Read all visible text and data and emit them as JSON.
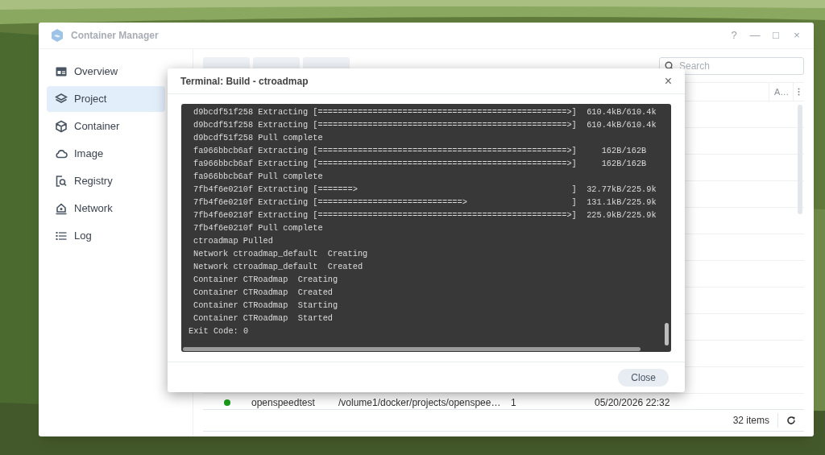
{
  "window": {
    "title": "Container Manager",
    "controls": [
      "?",
      "—",
      "□",
      "×"
    ]
  },
  "sidebar": {
    "items": [
      {
        "label": "Overview",
        "selected": false
      },
      {
        "label": "Project",
        "selected": true
      },
      {
        "label": "Container",
        "selected": false
      },
      {
        "label": "Image",
        "selected": false
      },
      {
        "label": "Registry",
        "selected": false
      },
      {
        "label": "Network",
        "selected": false
      },
      {
        "label": "Log",
        "selected": false
      }
    ]
  },
  "toolbar": {
    "search": {
      "placeholder": "Search"
    }
  },
  "table": {
    "columns": [
      {
        "label": "A…"
      }
    ],
    "rows": [
      {
        "color": "#1a9e1a",
        "name": "openspeedtest",
        "path": "/volume1/docker/projects/openspee…",
        "containers": "1",
        "created": "05/20/2026 22:32"
      }
    ],
    "item_count": "32 items"
  },
  "dialog": {
    "title": "Terminal: Build - ctroadmap",
    "close": "×",
    "lines": [
      "d9bcdf51f258 Extracting [==================================================>]  610.4kB/610.4k",
      "d9bcdf51f258 Extracting [==================================================>]  610.4kB/610.4k",
      "d9bcdf51f258 Pull complete",
      "fa966bbcb6af Extracting [==================================================>]     162B/162B",
      "fa966bbcb6af Extracting [==================================================>]     162B/162B",
      "fa966bbcb6af Pull complete",
      "7fb4f6e0210f Extracting [=======>                                           ]  32.77kB/225.9k",
      "7fb4f6e0210f Extracting [=============================>                     ]  131.1kB/225.9k",
      "7fb4f6e0210f Extracting [==================================================>]  225.9kB/225.9k",
      "7fb4f6e0210f Pull complete",
      "ctroadmap Pulled",
      "Network ctroadmap_default  Creating",
      "Network ctroadmap_default  Created",
      "Container CTRoadmap  Creating",
      "Container CTRoadmap  Created",
      "Container CTRoadmap  Starting",
      "Container CTRoadmap  Started"
    ],
    "exit_line": "Exit Code: 0",
    "buttons": [
      "Close"
    ]
  }
}
